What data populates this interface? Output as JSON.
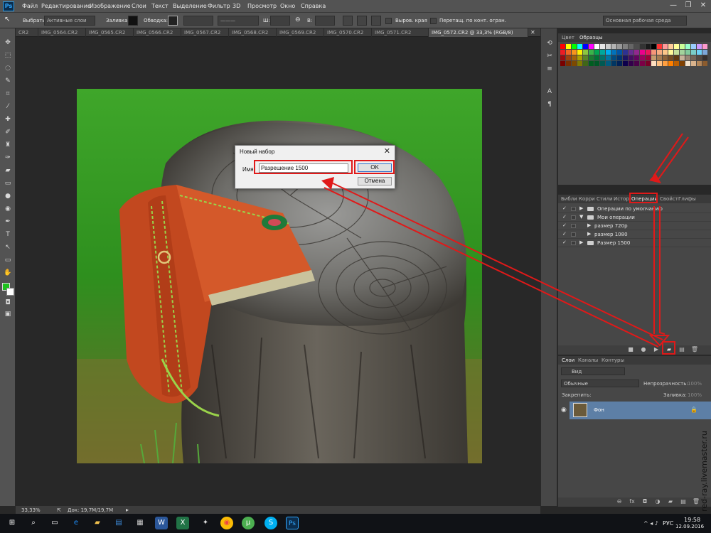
{
  "app": {
    "logo": "Ps"
  },
  "menu": [
    "Файл",
    "Редактирование",
    "Изображение",
    "Слои",
    "Текст",
    "Выделение",
    "Фильтр",
    "3D",
    "Просмотр",
    "Окно",
    "Справка"
  ],
  "window_controls": {
    "minimize": "—",
    "restore": "❐",
    "close": "✕"
  },
  "options": {
    "select_label": "Выбрать:",
    "select_value": "Активные слои",
    "fill_label": "Заливка:",
    "stroke_label": "Обводка:",
    "align_edges": "Выров. края",
    "constrain_path": "Перетащ. по конт. огран.",
    "workspace": "Основная рабочая среда"
  },
  "doc_tabs": [
    "CR2",
    "IMG_0564.CR2",
    "IMG_0565.CR2",
    "IMG_0566.CR2",
    "IMG_0567.CR2",
    "IMG_0568.CR2",
    "IMG_0569.CR2",
    "IMG_0570.CR2",
    "IMG_0571.CR2",
    "IMG_0572.CR2 @ 33,3% (RGB/8)"
  ],
  "status": {
    "zoom": "33,33%",
    "doc": "Док: 19,7M/19,7M"
  },
  "swatches_panel": {
    "tabs": [
      "Цвет",
      "Образцы"
    ]
  },
  "actions_panel": {
    "tabs": [
      "Библи",
      "Корри",
      "Стили",
      "Истор",
      "Операции",
      "Свойст",
      "Глифы"
    ],
    "rows": [
      {
        "label": "Операции по умолчанию"
      },
      {
        "label": "Мои операции"
      },
      {
        "label": "размер 720р"
      },
      {
        "label": "размер 1080"
      },
      {
        "label": "Размер 1500"
      }
    ]
  },
  "layers_panel": {
    "tabs": [
      "Слои",
      "Каналы",
      "Контуры"
    ],
    "kind": "Вид",
    "blend": "Обычные",
    "opacity_label": "Непрозрачность:",
    "opacity_value": "100%",
    "lock_label": "Закрепить:",
    "fill_label": "Заливка:",
    "fill_value": "100%",
    "layer_name": "Фон"
  },
  "dialog": {
    "title": "Новый набор",
    "name_label": "Имя:",
    "name_value": "Разрешение 1500",
    "ok": "OK",
    "cancel": "Отмена"
  },
  "taskbar": {
    "lang": "РУС",
    "time": "19:58",
    "date": "12.09.2016"
  },
  "watermark": "red-ray.livemaster.ru",
  "colors": {
    "accent_red": "#e01919",
    "selected_layer": "#5d7fa6",
    "ps_blue": "#31a8ff"
  }
}
